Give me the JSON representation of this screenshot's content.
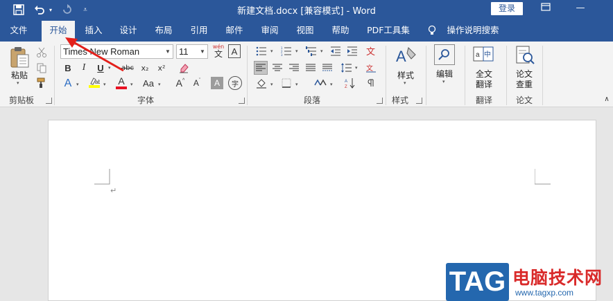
{
  "window": {
    "title": "新建文档.docx [兼容模式]  -  Word",
    "login_label": "登录",
    "accent_color": "#2b579a"
  },
  "quick_access": {
    "save_icon": "save-icon",
    "undo_icon": "undo-icon",
    "redo_icon": "redo-icon",
    "customize_icon": "customize-icon"
  },
  "tabs": [
    {
      "label": "文件",
      "active": false
    },
    {
      "label": "开始",
      "active": true
    },
    {
      "label": "插入",
      "active": false
    },
    {
      "label": "设计",
      "active": false
    },
    {
      "label": "布局",
      "active": false
    },
    {
      "label": "引用",
      "active": false
    },
    {
      "label": "邮件",
      "active": false
    },
    {
      "label": "审阅",
      "active": false
    },
    {
      "label": "视图",
      "active": false
    },
    {
      "label": "帮助",
      "active": false
    },
    {
      "label": "PDF工具集",
      "active": false
    }
  ],
  "tell_me": {
    "label": "操作说明搜索",
    "icon": "lightbulb-icon"
  },
  "groups": {
    "clipboard": {
      "label": "剪贴板",
      "paste_label": "粘贴"
    },
    "font": {
      "label": "字体",
      "font_name": "Times New Roman",
      "font_size": "11"
    },
    "paragraph": {
      "label": "段落"
    },
    "styles": {
      "label": "样式",
      "button_label": "样式"
    },
    "editing": {
      "button_label": "编辑"
    },
    "translate": {
      "label": "翻译",
      "button_label_line1": "全文",
      "button_label_line2": "翻译"
    },
    "paper": {
      "label": "论文",
      "button_label_line1": "论文",
      "button_label_line2": "查重"
    }
  },
  "font_buttons": {
    "bold": "B",
    "italic": "I",
    "underline": "U",
    "strikethrough": "abc",
    "subscript": "x₂",
    "superscript": "x²",
    "change_case": "Aa",
    "grow_font": "A",
    "shrink_font": "A",
    "font_color": "A",
    "text_effects": "A",
    "char_shading": "A",
    "enclose": "字",
    "phonetic_top": "wén",
    "phonetic_base": "文",
    "char_border": "A"
  },
  "colors": {
    "highlight": "#ffff00",
    "font_color": "#e81123",
    "accent_blue": "#2b579a",
    "watermark_blue": "#2467ae",
    "watermark_red": "#d92a2a"
  },
  "document": {
    "paragraph_mark": "↵"
  },
  "watermark": {
    "tag": "TAG",
    "brand": "电脑技术网",
    "url": "www.tagxp.com"
  }
}
